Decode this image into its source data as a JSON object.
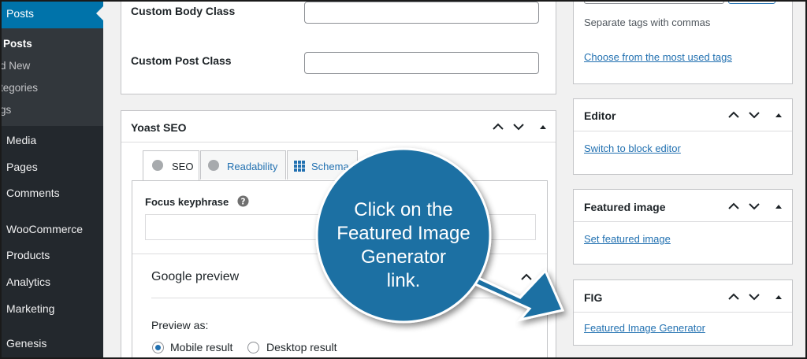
{
  "sidebar": {
    "posts_header": "Posts",
    "submenu": [
      "Posts",
      "d New",
      "tegories",
      "gs"
    ],
    "menu": [
      "Media",
      "Pages",
      "Comments",
      "WooCommerce",
      "Products",
      "Analytics",
      "Marketing",
      "Genesis"
    ]
  },
  "custom_fields": {
    "body_class_label": "Custom Body Class",
    "post_class_label": "Custom Post Class",
    "body_class_value": "",
    "post_class_value": ""
  },
  "yoast": {
    "title": "Yoast SEO",
    "tabs": [
      "SEO",
      "Readability",
      "Schema"
    ],
    "focus_label": "Focus keyphrase",
    "focus_value": "",
    "google_preview": "Google preview",
    "preview_as": "Preview as:",
    "mobile_result": "Mobile result",
    "desktop_result": "Desktop result"
  },
  "tags_box": {
    "hint": "Separate tags with commas",
    "link": "Choose from the most used tags"
  },
  "editor_box": {
    "title": "Editor",
    "link": "Switch to block editor"
  },
  "featured_box": {
    "title": "Featured image",
    "link": "Set featured image"
  },
  "fig_box": {
    "title": "FIG",
    "link": "Featured Image Generator"
  },
  "callout": {
    "lines": [
      "Click on the",
      "Featured Image",
      "Generator",
      "link."
    ],
    "color": "#1a6fa3"
  },
  "colors": {
    "accent": "#0073aa",
    "link": "#2271b1",
    "sidebar": "#23282d"
  }
}
